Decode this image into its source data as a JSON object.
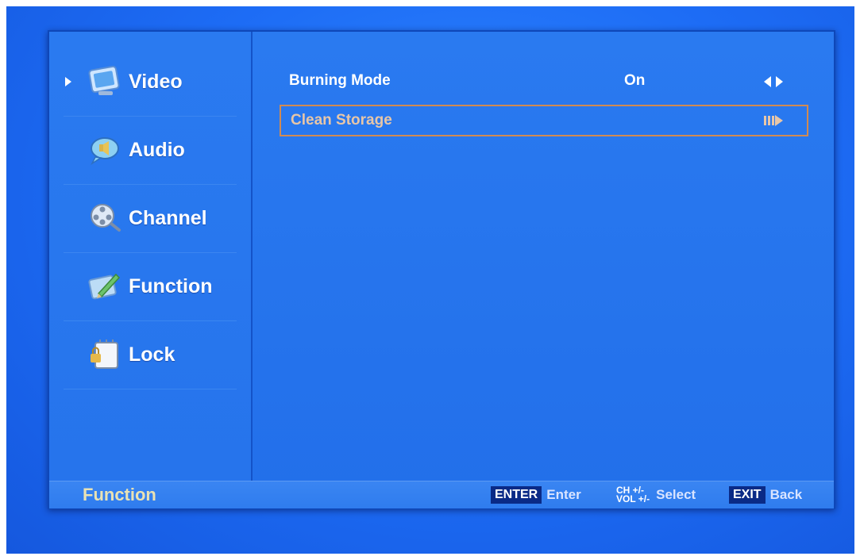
{
  "sidebar": {
    "items": [
      {
        "label": "Video",
        "icon": "video-icon",
        "active": true
      },
      {
        "label": "Audio",
        "icon": "audio-icon",
        "active": false
      },
      {
        "label": "Channel",
        "icon": "channel-icon",
        "active": false
      },
      {
        "label": "Function",
        "icon": "function-icon",
        "active": false
      },
      {
        "label": "Lock",
        "icon": "lock-icon",
        "active": false
      }
    ]
  },
  "main": {
    "rows": [
      {
        "label": "Burning Mode",
        "value": "On",
        "control_icon": "left-right-arrows-icon",
        "selected": false
      },
      {
        "label": "Clean Storage",
        "value": "",
        "control_icon": "enter-arrow-icon",
        "selected": true
      }
    ]
  },
  "footer": {
    "title": "Function",
    "hints": [
      {
        "key": "ENTER",
        "text": "Enter"
      },
      {
        "key_top": "CH +/-",
        "key_bottom": "VOL +/-",
        "text": "Select"
      },
      {
        "key": "EXIT",
        "text": "Back"
      }
    ]
  },
  "colors": {
    "background": "#1d6cf5",
    "panel": "#2674ec",
    "selection_border": "#d18a52",
    "footer_title": "#e9e2b4",
    "key_badge": "#0a2a86"
  }
}
